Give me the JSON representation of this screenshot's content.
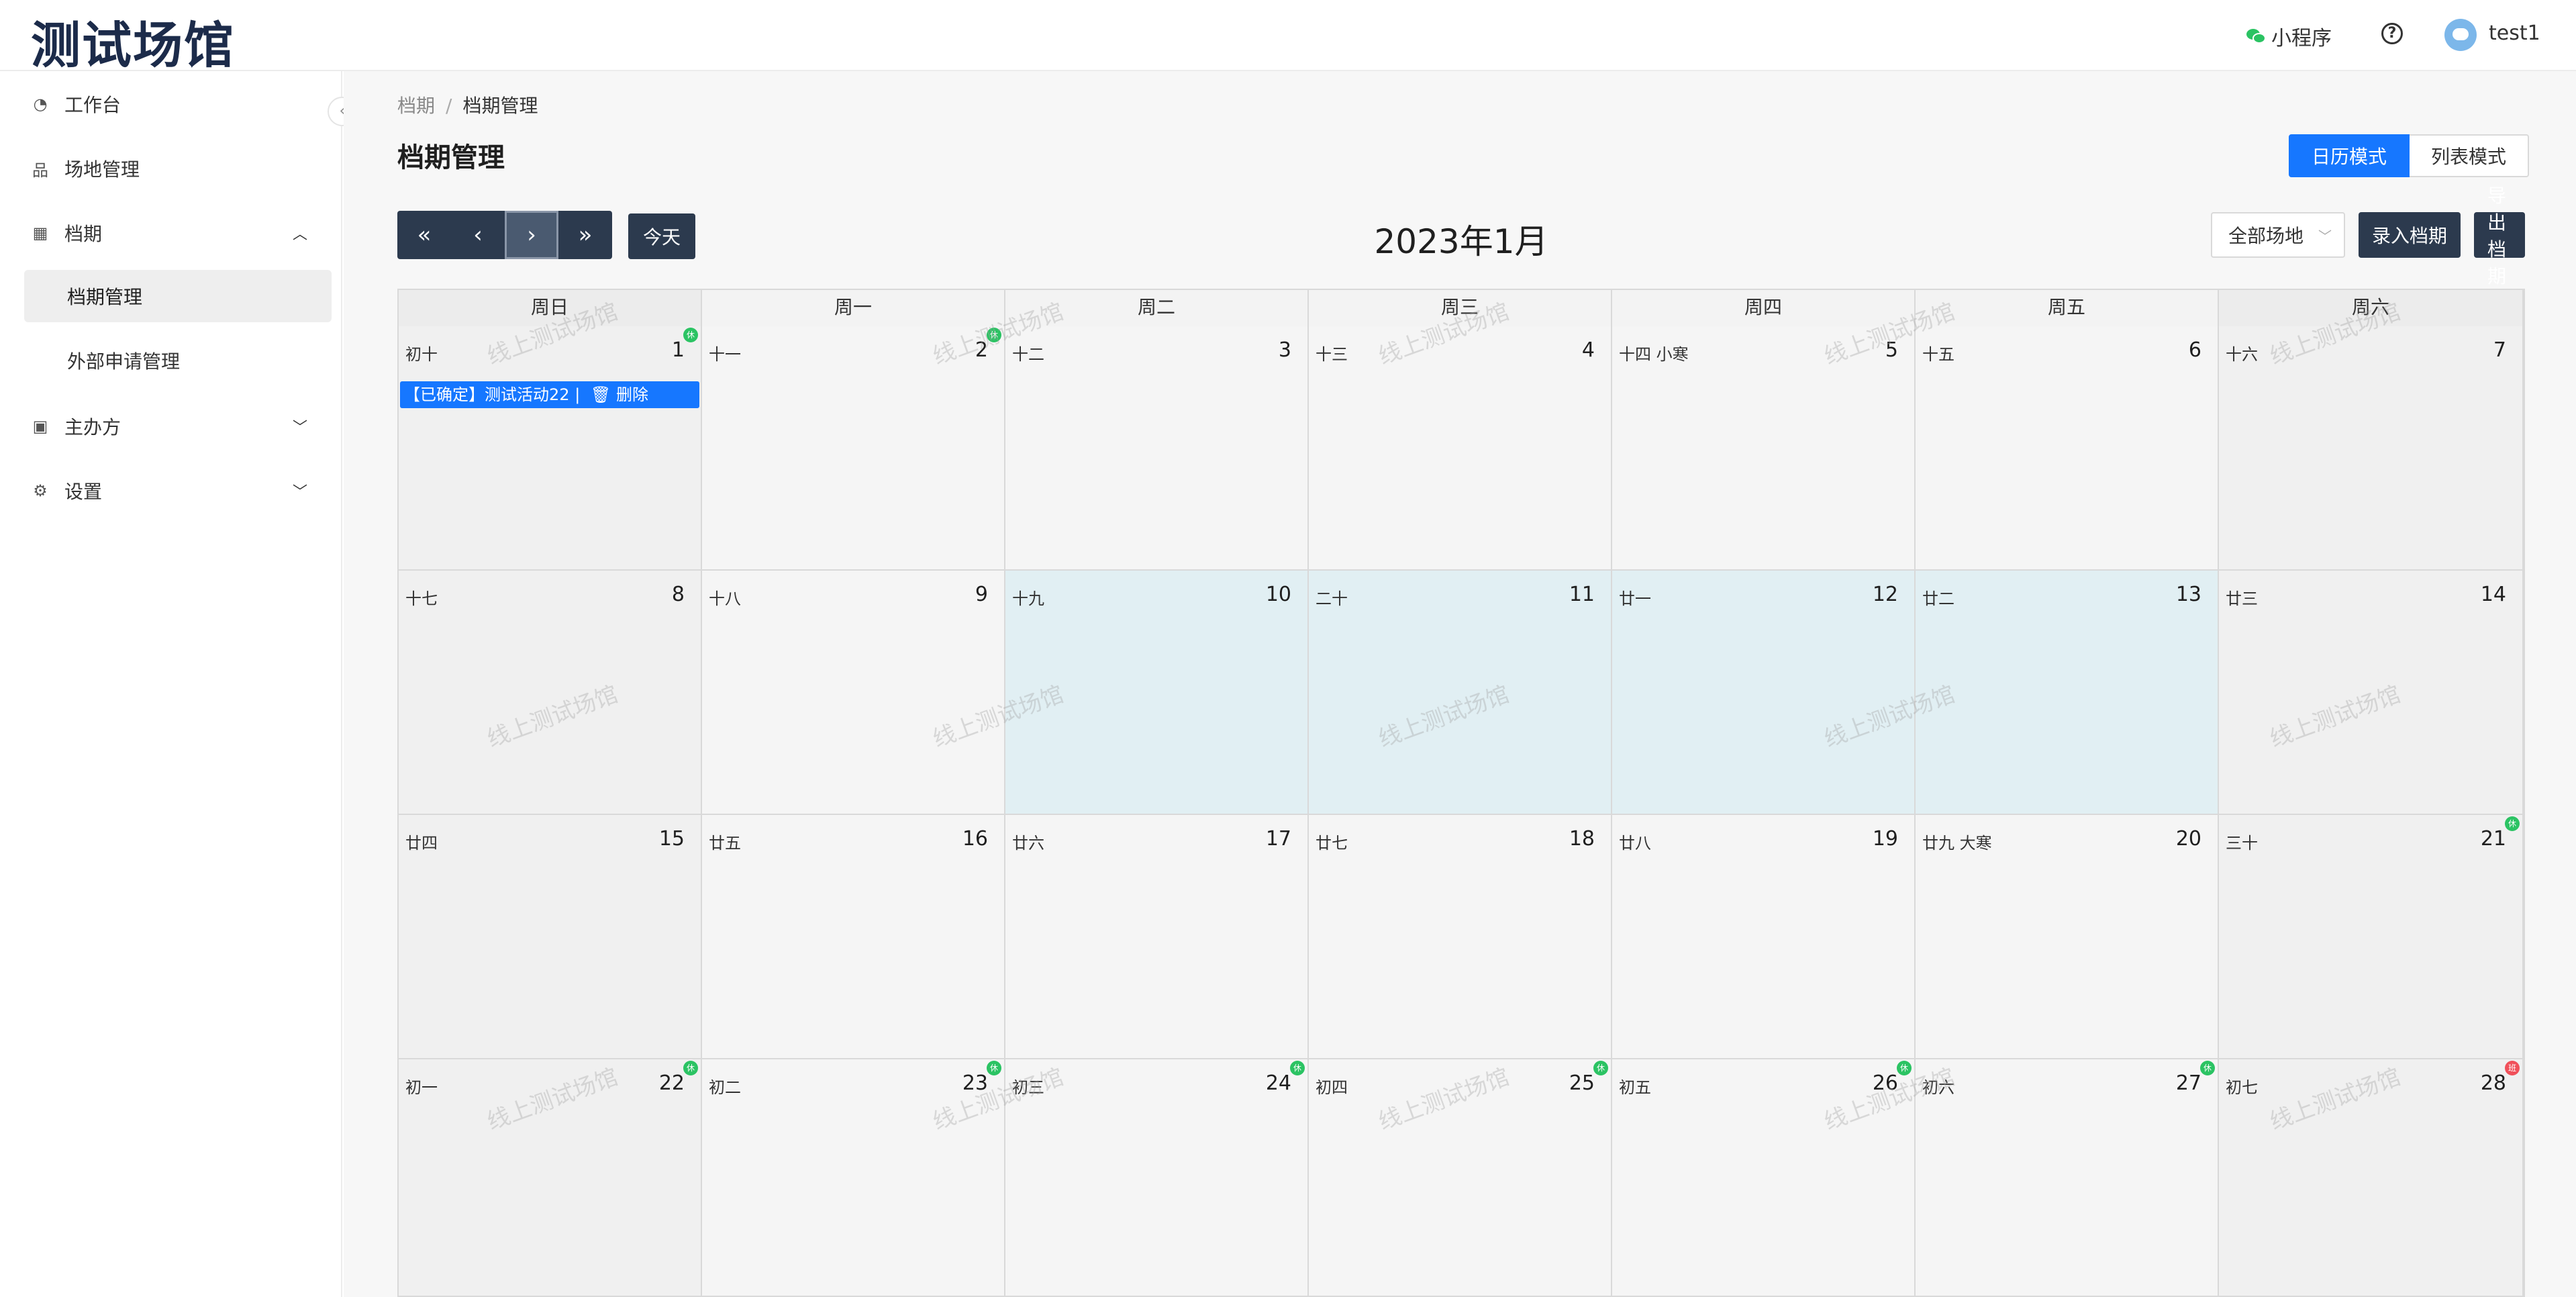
{
  "header": {
    "logo": "测试场馆",
    "mini_program": "小程序",
    "help": "?",
    "user": "test1"
  },
  "sidebar": {
    "items": [
      {
        "label": "工作台",
        "icon": "dashboard-icon"
      },
      {
        "label": "场地管理",
        "icon": "venue-icon"
      },
      {
        "label": "档期",
        "icon": "calendar-icon",
        "expanded": true
      },
      {
        "label": "主办方",
        "icon": "organizer-icon"
      },
      {
        "label": "设置",
        "icon": "gear-icon"
      }
    ],
    "subitems": [
      {
        "label": "档期管理",
        "active": true
      },
      {
        "label": "外部申请管理"
      }
    ]
  },
  "breadcrumb": {
    "root": "档期",
    "sep": "/",
    "current": "档期管理"
  },
  "page": {
    "title": "档期管理"
  },
  "modes": {
    "calendar": "日历模式",
    "list": "列表模式",
    "selected": "日历模式"
  },
  "toolbar": {
    "today": "今天",
    "month_title": "2023年1月",
    "venue_select": "全部场地",
    "enter_schedule": "录入档期",
    "export_schedule": "导出档期"
  },
  "calendar": {
    "weekdays": [
      "周日",
      "周一",
      "周二",
      "周三",
      "周四",
      "周五",
      "周六"
    ],
    "weeks": [
      [
        {
          "lunar": "初十",
          "day": "1",
          "badge": "休"
        },
        {
          "lunar": "十一",
          "day": "2",
          "badge": "休"
        },
        {
          "lunar": "十二",
          "day": "3"
        },
        {
          "lunar": "十三",
          "day": "4"
        },
        {
          "lunar": "十四 小寒",
          "day": "5"
        },
        {
          "lunar": "十五",
          "day": "6"
        },
        {
          "lunar": "十六",
          "day": "7"
        }
      ],
      [
        {
          "lunar": "十七",
          "day": "8"
        },
        {
          "lunar": "十八",
          "day": "9"
        },
        {
          "lunar": "十九",
          "day": "10",
          "highlight": true
        },
        {
          "lunar": "二十",
          "day": "11",
          "highlight": true
        },
        {
          "lunar": "廿一",
          "day": "12",
          "highlight": true
        },
        {
          "lunar": "廿二",
          "day": "13",
          "highlight": true
        },
        {
          "lunar": "廿三",
          "day": "14"
        }
      ],
      [
        {
          "lunar": "廿四",
          "day": "15"
        },
        {
          "lunar": "廿五",
          "day": "16"
        },
        {
          "lunar": "廿六",
          "day": "17"
        },
        {
          "lunar": "廿七",
          "day": "18"
        },
        {
          "lunar": "廿八",
          "day": "19"
        },
        {
          "lunar": "廿九 大寒",
          "day": "20"
        },
        {
          "lunar": "三十",
          "day": "21",
          "badge": "休"
        }
      ],
      [
        {
          "lunar": "初一",
          "day": "22",
          "badge": "休"
        },
        {
          "lunar": "初二",
          "day": "23",
          "badge": "休"
        },
        {
          "lunar": "初三",
          "day": "24",
          "badge": "休"
        },
        {
          "lunar": "初四",
          "day": "25",
          "badge": "休"
        },
        {
          "lunar": "初五",
          "day": "26",
          "badge": "休"
        },
        {
          "lunar": "初六",
          "day": "27",
          "badge": "休"
        },
        {
          "lunar": "初七",
          "day": "28",
          "badge": "班",
          "badge_color": "red"
        }
      ]
    ],
    "event": {
      "text": "【已确定】测试活动22",
      "sep": "|",
      "delete": "删除"
    }
  },
  "watermark": "线上测试场馆",
  "colors": {
    "primary": "#1677ff",
    "dark_button": "#2c3a4e",
    "highlight": "#e1eff3",
    "badge_green": "#2bc363",
    "badge_red": "#f0505a"
  }
}
